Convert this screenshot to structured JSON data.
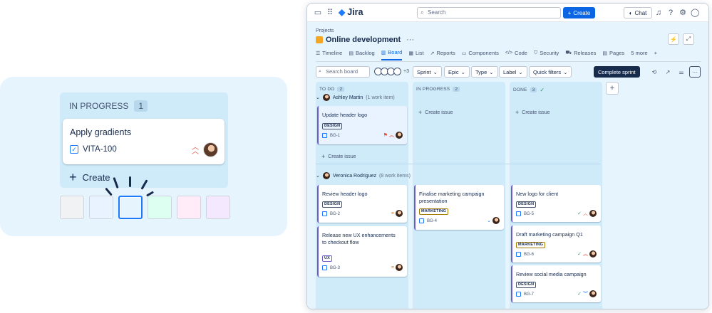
{
  "promo": {
    "column_title": "IN PROGRESS",
    "column_count": "1",
    "card_title": "Apply gradients",
    "card_key": "VITA-100",
    "create_label": "Create",
    "swatch_colors": [
      "#f1f2f4",
      "#e9f2ff",
      "#e6f4fd",
      "#dcfff1",
      "#ffecf8",
      "#f3e8fd"
    ]
  },
  "topbar": {
    "app_name": "Jira",
    "search_placeholder": "Search",
    "create_label": "Create",
    "chat_label": "Chat"
  },
  "project": {
    "breadcrumb": "Projects",
    "title": "Online development",
    "more": "···"
  },
  "tabs": [
    {
      "label": "Timeline"
    },
    {
      "label": "Backlog"
    },
    {
      "label": "Board"
    },
    {
      "label": "List"
    },
    {
      "label": "Reports"
    },
    {
      "label": "Components"
    },
    {
      "label": "Code"
    },
    {
      "label": "Security"
    },
    {
      "label": "Releases"
    },
    {
      "label": "Pages"
    },
    {
      "label": "5 more"
    }
  ],
  "filters": {
    "search_placeholder": "Search board",
    "avatars_more": "+3",
    "sprint": "Sprint",
    "epic": "Epic",
    "type": "Type",
    "label": "Label",
    "quick": "Quick filters",
    "complete_sprint": "Complete sprint"
  },
  "columns": [
    {
      "title": "TO DO",
      "count": "2"
    },
    {
      "title": "IN PROGRESS",
      "count": "2"
    },
    {
      "title": "DONE",
      "count": "3"
    }
  ],
  "swimlanes": [
    {
      "name": "Ashley Martin",
      "sub": "(1 work item)"
    },
    {
      "name": "Veronica Rodriguez",
      "sub": "(8 work items)"
    }
  ],
  "create_issue": "Create issue",
  "cards": {
    "bg1": {
      "title": "Update header logo",
      "label": "DESIGN",
      "key": "BG-1"
    },
    "bg2": {
      "title": "Review header logo",
      "label": "DESIGN",
      "key": "BG-2"
    },
    "bg3": {
      "title": "Release new UX enhancements to checkout flow",
      "label": "UX",
      "key": "BG-3"
    },
    "bg4": {
      "title": "Finalise marketing campaign presentation",
      "label": "MARKETING",
      "key": "BG-4"
    },
    "bg5": {
      "title": "New logo for client",
      "label": "DESIGN",
      "key": "BG-5"
    },
    "bg6": {
      "title": "Draft marketing campaign Q1",
      "label": "MARKETING",
      "key": "BG-6"
    },
    "bg7": {
      "title": "Review social media campaign",
      "label": "DESIGN",
      "key": "BG-7"
    }
  }
}
